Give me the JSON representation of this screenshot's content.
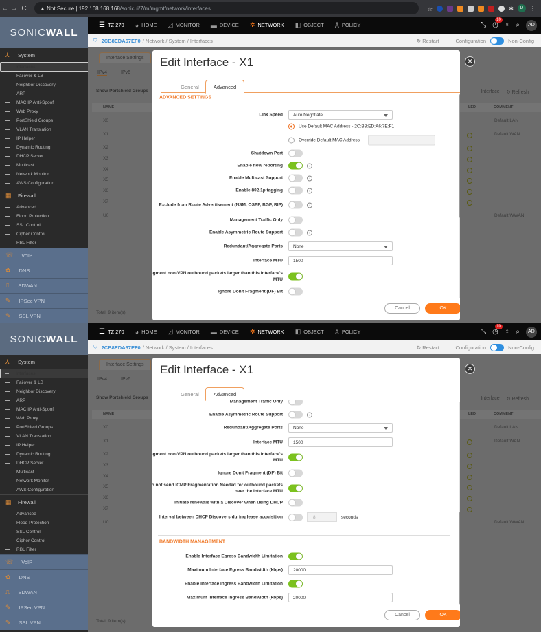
{
  "browser": {
    "security": "Not Secure",
    "host": "192.168.168.168",
    "path": "/sonicui/7/m/mgmt/network/interfaces",
    "profile": "D"
  },
  "app": {
    "logo_light": "SONIC",
    "logo_bold": "WALL",
    "device": "TZ 270",
    "nav": [
      {
        "label": "HOME",
        "icon": "home-icon"
      },
      {
        "label": "MONITOR",
        "icon": "monitor-icon"
      },
      {
        "label": "DEVICE",
        "icon": "device-icon"
      },
      {
        "label": "NETWORK",
        "icon": "network-icon",
        "active": true
      },
      {
        "label": "OBJECT",
        "icon": "object-icon"
      },
      {
        "label": "POLICY",
        "icon": "policy-icon"
      }
    ],
    "notifications": "10",
    "avatar": "AD",
    "breadcrumb": {
      "serial": "2CB8EDA67EF0",
      "path": "/ Network / System / Interfaces"
    },
    "restart": "Restart",
    "config_left": "Configuration",
    "config_right": "Non-Config"
  },
  "sidebar": {
    "system": "System",
    "system_items": [
      "Interfaces",
      "Failover & LB",
      "Neighbor Discovery",
      "ARP",
      "MAC IP Anti-Spoof",
      "Web Proxy",
      "PortShield Groups",
      "VLAN Translation",
      "IP Helper",
      "Dynamic Routing",
      "DHCP Server",
      "Multicast",
      "Network Monitor",
      "AWS Configuration"
    ],
    "firewall": "Firewall",
    "firewall_items": [
      "Advanced",
      "Flood Protection",
      "SSL Control",
      "Cipher Control",
      "RBL Filter"
    ],
    "groups": [
      "VoIP",
      "DNS",
      "SDWAN",
      "IPSec VPN",
      "SSL VPN"
    ]
  },
  "background": {
    "tab": "Interface Settings",
    "subtabs": [
      "IPv4",
      "IPv6"
    ],
    "show_portshield": "Show Portshield Groups",
    "add_interface": "Interface",
    "refresh": "Refresh",
    "columns": {
      "name": "NAME",
      "led": "LED",
      "comment": "COMMENT"
    },
    "rows": [
      {
        "name": "X0",
        "comment": "Default LAN"
      },
      {
        "name": "X1",
        "comment": "Default WAN"
      },
      {
        "name": "X2",
        "comment": ""
      },
      {
        "name": "X3",
        "comment": ""
      },
      {
        "name": "X4",
        "comment": ""
      },
      {
        "name": "X5",
        "comment": ""
      },
      {
        "name": "X6",
        "comment": ""
      },
      {
        "name": "X7",
        "comment": ""
      },
      {
        "name": "U0",
        "comment": "Default WWAN"
      }
    ],
    "total": "Total: 9 item(s)"
  },
  "modal": {
    "title": "Edit Interface - X1",
    "tabs": [
      "General",
      "Advanced"
    ],
    "cancel": "Cancel",
    "ok": "OK"
  },
  "view1": {
    "heading": "ADVANCED SETTINGS",
    "rows": [
      {
        "type": "select",
        "label": "Link Speed",
        "value": "Auto Negotiate"
      },
      {
        "type": "radio",
        "text": "Use Default MAC Address - 2C:B8:ED:A6:7E:F1",
        "checked": true
      },
      {
        "type": "radio",
        "text": "Override Default MAC Address",
        "checked": false,
        "box": true
      },
      {
        "type": "switch",
        "label": "Shutdown Port",
        "on": false
      },
      {
        "type": "switch",
        "label": "Enable flow reporting",
        "on": true,
        "info": true
      },
      {
        "type": "switch",
        "label": "Enable Multicast Support",
        "on": false,
        "info": true
      },
      {
        "type": "switch",
        "label": "Enable 802.1p tagging",
        "on": false,
        "info": true
      },
      {
        "type": "switch",
        "label": "Exclude from Route Advertisement (NSM, OSPF, BGP, RIP)",
        "on": false,
        "info": true
      },
      {
        "type": "switch",
        "label": "Management Traffic Only",
        "on": false
      },
      {
        "type": "switch",
        "label": "Enable Asymmetric Route Support",
        "on": false,
        "info": true
      },
      {
        "type": "select",
        "label": "Redundant/Aggregate Ports",
        "value": "None"
      },
      {
        "type": "input",
        "label": "Interface MTU",
        "value": "1500"
      },
      {
        "type": "switch",
        "label": "Fragment non-VPN outbound packets larger than this Interface's MTU",
        "on": true
      },
      {
        "type": "switch",
        "label": "Ignore Don't Fragment (DF) Bit",
        "on": false
      }
    ]
  },
  "view2": {
    "heading": "BANDWIDTH MANAGEMENT",
    "rows": [
      {
        "type": "switch",
        "label": "Management Traffic Only",
        "on": false
      },
      {
        "type": "switch",
        "label": "Enable Asymmetric Route Support",
        "on": false,
        "info": true
      },
      {
        "type": "select",
        "label": "Redundant/Aggregate Ports",
        "value": "None"
      },
      {
        "type": "input",
        "label": "Interface MTU",
        "value": "1500"
      },
      {
        "type": "switch",
        "label": "Fragment non-VPN outbound packets larger than this Interface's MTU",
        "on": true
      },
      {
        "type": "switch",
        "label": "Ignore Don't Fragment (DF) Bit",
        "on": false
      },
      {
        "type": "switch",
        "label": "Do not send ICMP Fragmentation Needed for outbound packets over the Interface MTU",
        "on": true
      },
      {
        "type": "switch",
        "label": "Initiate renewals with a Discover when using DHCP",
        "on": false
      },
      {
        "type": "interval",
        "label": "Interval between DHCP Discovers during lease acquisition",
        "on": false,
        "value": "8",
        "unit": "seconds"
      },
      {
        "type": "switch",
        "label": "Enable Interface Egress Bandwidth Limitation",
        "on": true
      },
      {
        "type": "input",
        "label": "Maximum Interface Egress Bandwidth (kbps)",
        "value": "20000"
      },
      {
        "type": "switch",
        "label": "Enable Interface Ingress Bandwidth Limitation",
        "on": true
      },
      {
        "type": "input",
        "label": "Maximum Interface Ingress Bandwidth (kbps)",
        "value": "20000"
      }
    ]
  },
  "colors": {
    "accent": "#ff7a1a",
    "switch_on": "#7cc21e",
    "link": "#3a8fd6"
  }
}
